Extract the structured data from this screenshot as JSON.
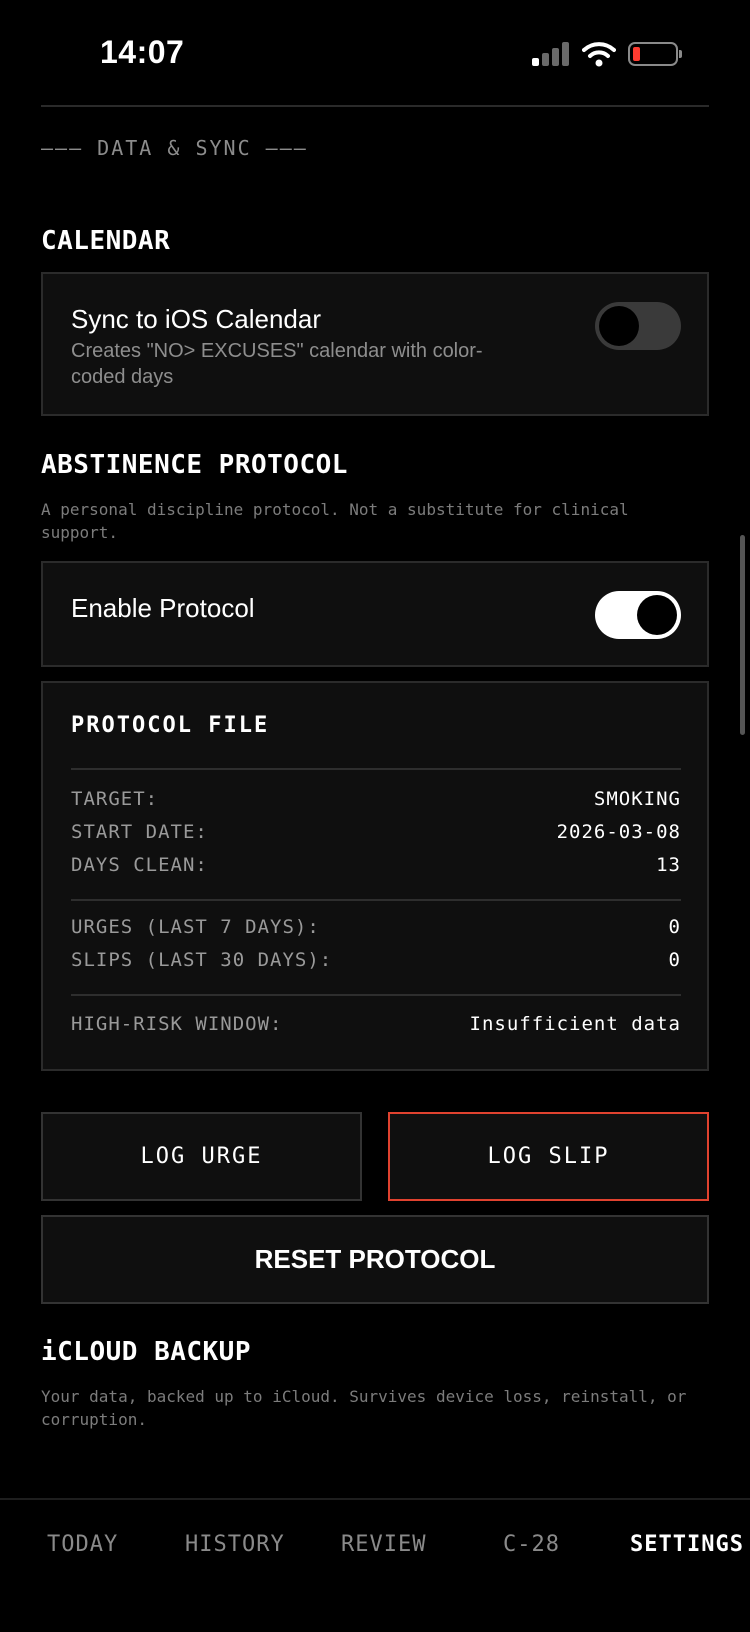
{
  "status_bar": {
    "time": "14:07"
  },
  "section_label": "——— DATA & SYNC ———",
  "calendar": {
    "heading": "CALENDAR",
    "title": "Sync to iOS Calendar",
    "subtitle_line1": "Creates \"NO> EXCUSES\" calendar with color-",
    "subtitle_line2": "coded days",
    "toggle_on": false
  },
  "protocol": {
    "heading": "ABSTINENCE PROTOCOL",
    "note": "A personal discipline protocol. Not a substitute for clinical support.",
    "enable_label": "Enable Protocol",
    "toggle_on": true
  },
  "protocol_file": {
    "title": "PROTOCOL FILE",
    "rows": [
      {
        "label": "TARGET:",
        "value": "SMOKING"
      },
      {
        "label": "START DATE:",
        "value": "2026-03-08"
      },
      {
        "label": "DAYS CLEAN:",
        "value": "13"
      },
      {
        "label": "URGES (LAST 7 DAYS):",
        "value": "0"
      },
      {
        "label": "SLIPS (LAST 30 DAYS):",
        "value": "0"
      },
      {
        "label": "HIGH-RISK WINDOW:",
        "value": "Insufficient data"
      }
    ]
  },
  "actions": {
    "log_urge": "LOG URGE",
    "log_slip": "LOG SLIP",
    "reset": "RESET PROTOCOL"
  },
  "icloud": {
    "heading": "iCLOUD BACKUP",
    "note_line1": "Your data, backed up to iCloud. Survives device loss, reinstall, or",
    "note_line2": "corruption."
  },
  "tabs": [
    "TODAY",
    "HISTORY",
    "REVIEW",
    "C-28",
    "SETTINGS"
  ],
  "colors": {
    "accent_danger": "#e0422f",
    "battery_low": "#ff3b30"
  }
}
